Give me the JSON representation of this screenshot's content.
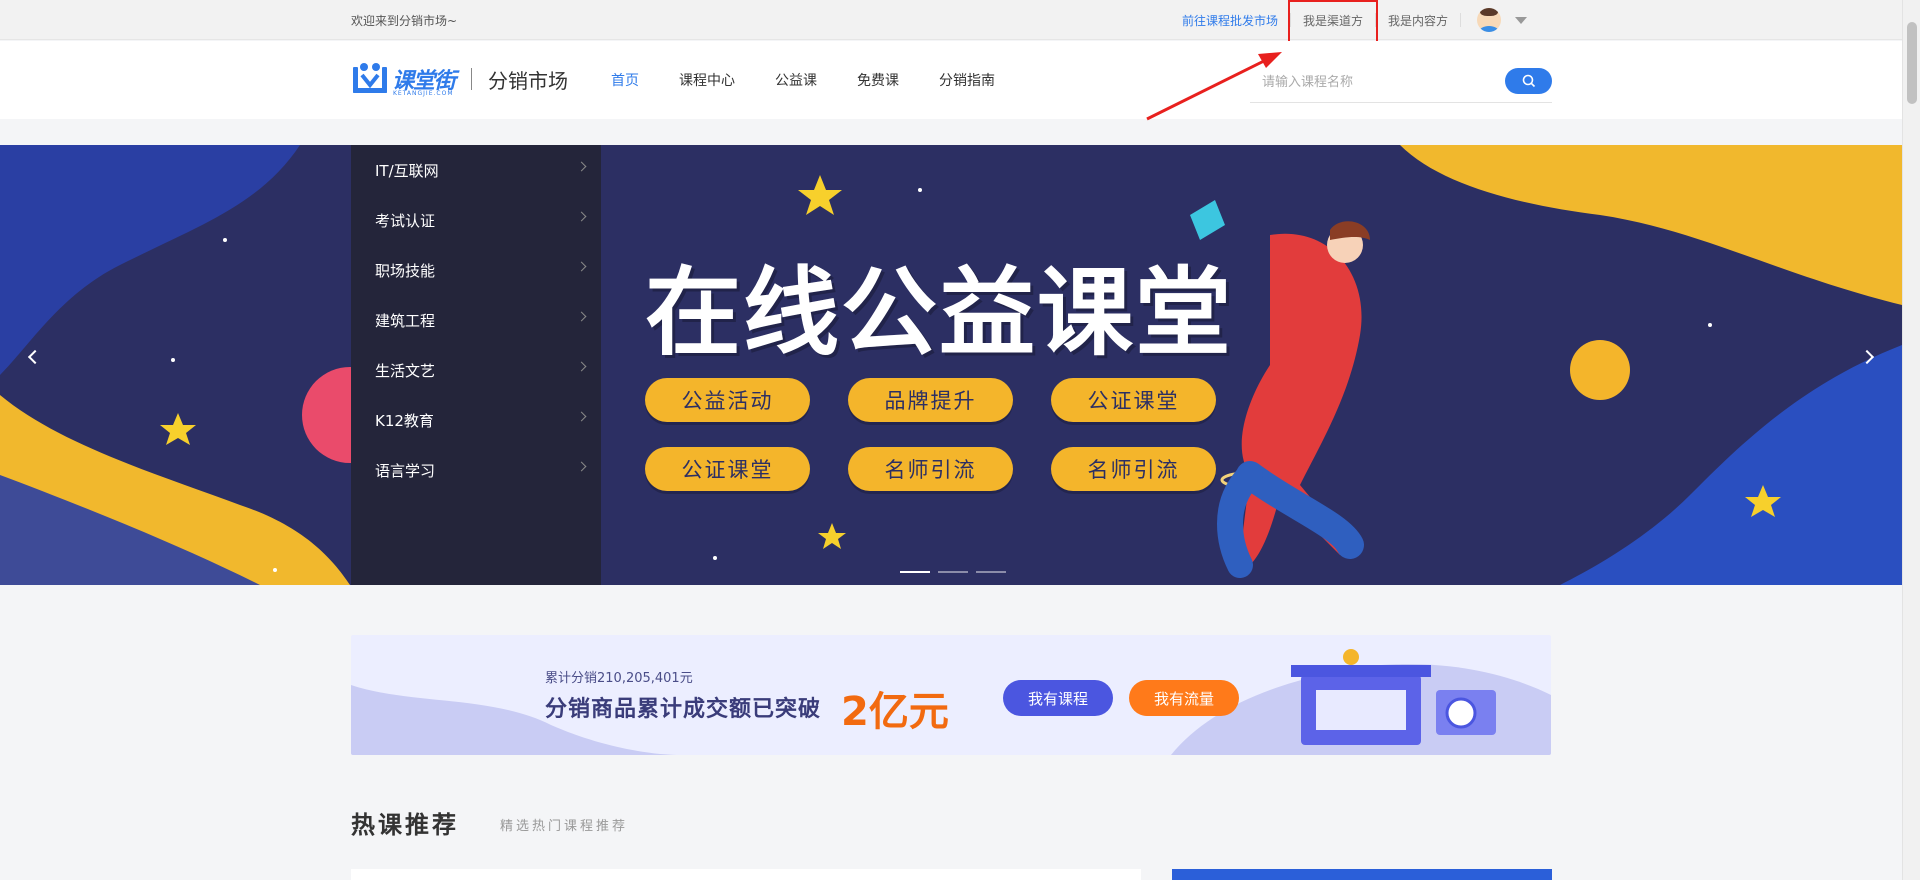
{
  "topbar": {
    "welcome": "欢迎来到分销市场~",
    "links": {
      "wholesale": "前往课程批发市场",
      "channel": "我是渠道方",
      "content": "我是内容方"
    }
  },
  "header": {
    "logo_text": "课堂街",
    "logo_sub": "KETANGJIE.COM",
    "market_name": "分销市场",
    "nav": [
      "首页",
      "课程中心",
      "公益课",
      "免费课",
      "分销指南"
    ],
    "search_placeholder": "请输入课程名称"
  },
  "categories": [
    "IT/互联网",
    "考试认证",
    "职场技能",
    "建筑工程",
    "生活文艺",
    "K12教育",
    "语言学习"
  ],
  "banner": {
    "title": "在线公益课堂",
    "pills": [
      "公益活动",
      "品牌提升",
      "公证课堂",
      "公证课堂",
      "名师引流",
      "名师引流"
    ],
    "slide_count": 3,
    "active_slide": 1
  },
  "promo": {
    "stat": "累计分销210,205,401元",
    "headline": "分销商品累计成交额已突破",
    "big": "2亿元",
    "btn_course": "我有课程",
    "btn_traffic": "我有流量"
  },
  "hot": {
    "title": "热课推荐",
    "subtitle": "精选热门课程推荐"
  },
  "colors": {
    "accent": "#2f7bea",
    "highlight": "#e8201e",
    "banner_bg": "#2c2f63",
    "pill": "#f4b52b",
    "promo_orange": "#f26a10"
  }
}
